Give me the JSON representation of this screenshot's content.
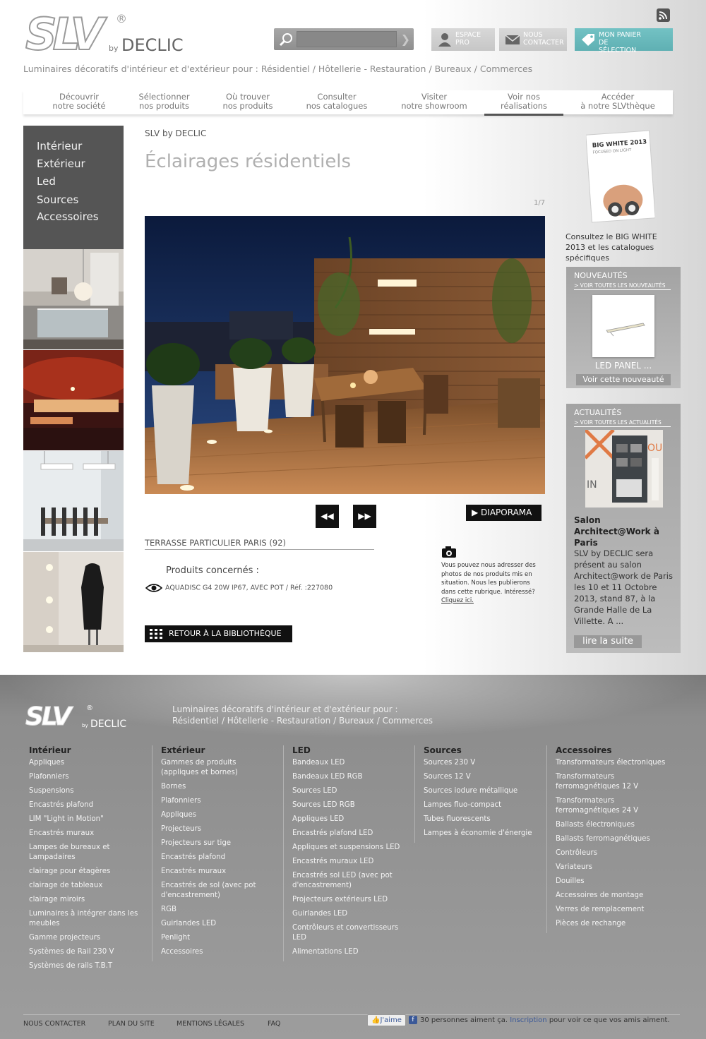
{
  "header": {
    "logo_text": "SLV",
    "logo_reg": "®",
    "logo_by": "by",
    "logo_brand": "DECLIC",
    "tagline": "Luminaires décoratifs d'intérieur et d'extérieur pour : Résidentiel / Hôtellerie - Restauration / Bureaux / Commerces",
    "search_placeholder": "",
    "buttons": {
      "pro": [
        "ESPACE",
        "PRO"
      ],
      "contact": [
        "NOUS",
        "CONTACTER"
      ],
      "panier": [
        "MON PANIER",
        "DE SÉLECTION"
      ]
    },
    "accent_color": "#65b8bb"
  },
  "nav": [
    {
      "l1": "Découvrir",
      "l2": "notre société"
    },
    {
      "l1": "Sélectionner",
      "l2": "nos produits"
    },
    {
      "l1": "Où trouver",
      "l2": "nos produits"
    },
    {
      "l1": "Consulter",
      "l2": "nos catalogues"
    },
    {
      "l1": "Visiter",
      "l2": "notre showroom"
    },
    {
      "l1": "Voir nos",
      "l2": "réalisations",
      "active": true
    },
    {
      "l1": "Accéder",
      "l2": "à notre SLVthèque"
    }
  ],
  "catmenu": [
    "Intérieur",
    "Extérieur",
    "Led",
    "Sources",
    "Accessoires"
  ],
  "main": {
    "breadcrumb": "SLV by DECLIC",
    "title": "Éclairages résidentiels",
    "counter": "1/7",
    "diaporama": "DIAPORAMA",
    "project": "TERRASSE PARTICULIER PARIS (92)",
    "products_heading": "Produits concernés :",
    "product_line": "AQUADISC G4 20W IP67, AVEC POT / Réf. :227080",
    "back": "RETOUR À LA BIBLIOTHÈQUE",
    "photo_note": "Vous pouvez nous adresser des photos de nos produits mis en situation. Nous les publierons dans cette rubrique. Intéressé?",
    "photo_note_link": "Cliquez ici."
  },
  "sidebar": {
    "cover_title": "BIG WHITE 2013",
    "cover_sub": "FOCUSED ON LIGHT",
    "cover_caption": "Consultez le BIG WHITE 2013 et les catalogues spécifiques",
    "nouv_heading": "NOUVEAUTÉS",
    "nouv_link": "> VOIR TOUTES LES NOUVEAUTÉS",
    "nouv_name": "LED PANEL ...",
    "nouv_btn": "Voir cette nouveauté",
    "actu_heading": "ACTUALITÉS",
    "actu_link": "> VOIR TOUTES LES ACTUALITÉS",
    "actu_title": "Salon Architect@Work à Paris",
    "actu_text": "SLV by DECLIC sera présent au salon Architect@work de Paris les 10 et 11 Octobre 2013, stand 87, à la Grande Halle de La Villette.    A ...",
    "actu_btn": "lire la suite"
  },
  "footer": {
    "tagline1": "Luminaires décoratifs d'intérieur et d'extérieur pour :",
    "tagline2": "Résidentiel / Hôtellerie - Restauration / Bureaux / Commerces",
    "columns": [
      {
        "title": "Intérieur",
        "items": [
          "Appliques",
          "Plafonniers",
          "Suspensions",
          "Encastrés plafond",
          "LIM \"Light in Motion\"",
          "Encastrés muraux",
          "Lampes de bureaux et Lampadaires",
          "clairage pour étagères",
          "clairage de tableaux",
          "clairage miroirs",
          "Luminaires à intégrer dans les meubles",
          "Gamme projecteurs",
          "Systèmes de Rail 230 V",
          "Systèmes de rails T.B.T"
        ]
      },
      {
        "title": "Extérieur",
        "items": [
          "Gammes de produits (appliques et bornes)",
          "Bornes",
          "Plafonniers",
          "Appliques",
          "Projecteurs",
          "Projecteurs sur tige",
          "Encastrés plafond",
          "Encastrés muraux",
          "Encastrés de sol (avec pot d'encastrement)",
          "RGB",
          "Guirlandes LED",
          "Penlight",
          "Accessoires"
        ]
      },
      {
        "title": "LED",
        "items": [
          "Bandeaux LED",
          "Bandeaux LED RGB",
          "Sources LED",
          "Sources LED RGB",
          "Appliques LED",
          "Encastrés plafond LED",
          "Appliques et suspensions LED",
          "Encastrés muraux LED",
          "Encastrés sol LED (avec pot d'encastrement)",
          "Projecteurs extérieurs LED",
          "Guirlandes LED",
          "Contrôleurs et convertisseurs LED",
          "Alimentations LED"
        ]
      },
      {
        "title": "Sources",
        "items": [
          "Sources 230 V",
          "Sources 12 V",
          "Sources iodure métallique",
          "Lampes fluo-compact",
          "Tubes fluorescents",
          "Lampes à économie d'énergie"
        ]
      },
      {
        "title": "Accessoires",
        "items": [
          "Transformateurs électroniques",
          "Transformateurs ferromagnétiques 12 V",
          "Transformateurs ferromagnétiques 24 V",
          "Ballasts électroniques",
          "Ballasts ferromagnétiques",
          "Contrôleurs",
          "Variateurs",
          "Douilles",
          "Accessoires de montage",
          "Verres de remplacement",
          "Pièces de rechange"
        ]
      }
    ],
    "links": [
      "NOUS CONTACTER",
      "PLAN DU SITE",
      "MENTIONS LÉGALES",
      "FAQ"
    ],
    "fb_like": "J'aime",
    "fb_text": "30 personnes aiment ça.",
    "fb_link": "Inscription",
    "fb_text2": "pour voir ce que vos amis aiment."
  }
}
